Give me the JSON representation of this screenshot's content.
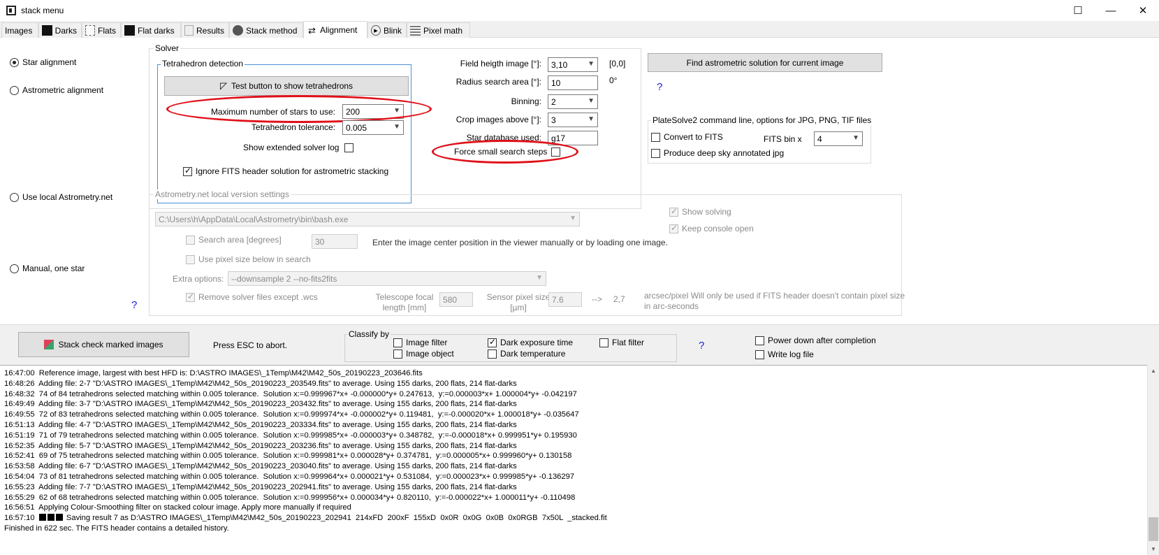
{
  "window": {
    "title": "stack menu",
    "minimize": "—",
    "maximize": "☐",
    "close": "✕"
  },
  "tabs": [
    {
      "label": "Images",
      "icon": "none"
    },
    {
      "label": "Darks",
      "icon": "darks-icon"
    },
    {
      "label": "Flats",
      "icon": "flats-icon"
    },
    {
      "label": "Flat darks",
      "icon": "flat-darks-icon"
    },
    {
      "label": "Results",
      "icon": "results-icon"
    },
    {
      "label": "Stack method",
      "icon": "stack-method-icon"
    },
    {
      "label": "Alignment",
      "icon": "alignment-icon"
    },
    {
      "label": "Blink",
      "icon": "blink-icon"
    },
    {
      "label": "Pixel math",
      "icon": "pixel-math-icon"
    }
  ],
  "alignment": {
    "radios": {
      "star": "Star alignment",
      "astrometric": "Astrometric alignment",
      "local_astrometry": "Use local Astrometry.net",
      "manual": "Manual, one star"
    },
    "solver": {
      "group_label": "Solver",
      "tetra_group_label": "Tetrahedron detection",
      "test_button": "Test button to show tetrahedrons",
      "max_stars_label": "Maximum number of stars to use:",
      "max_stars_value": "200",
      "tolerance_label": "Tetrahedron tolerance:",
      "tolerance_value": "0.005",
      "show_log_label": "Show extended solver log",
      "field_label": "Field heigth image [°]:",
      "field_value": "3,10",
      "field_readout": "[0,0]",
      "radius_label": "Radius search area [°]:",
      "radius_value": "10",
      "radius_unit": "0°",
      "binning_label": "Binning:",
      "binning_value": "2",
      "crop_label": "Crop images above [°]:",
      "crop_value": "3",
      "db_label": "Star database used:",
      "db_value": "g17",
      "force_label": "Force small search steps"
    },
    "find_button": "Find astrometric solution for current image",
    "help": "?",
    "platesolve": {
      "group_label": "PlateSolve2 command line, options for JPG, PNG, TIF files",
      "convert_label": "Convert to FITS",
      "bin_label": "FITS bin x",
      "bin_value": "4",
      "annotated_label": "Produce deep sky annotated jpg"
    },
    "ignore_fits_label": "Ignore FITS header solution for astrometric stacking",
    "astrometry_net": {
      "group_label": "Astrometry.net local version settings",
      "path_value": "C:\\Users\\h\\AppData\\Local\\Astrometry\\bin\\bash.exe",
      "show_solving": "Show solving",
      "keep_console": "Keep console open",
      "search_area_label": "Search area [degrees]",
      "search_area_value": "30",
      "center_hint": "Enter the image center position in the viewer manually or by loading one image.",
      "pixel_size_label": "Use pixel size below in search",
      "extra_label": "Extra options:",
      "extra_value": "--downsample 2 --no-fits2fits",
      "remove_label": "Remove solver files except .wcs",
      "focal_label_1": "Telescope focal",
      "focal_label_2": "length [mm]",
      "focal_value": "580",
      "sensor_label_1": "Sensor pixel size",
      "sensor_label_2": "[µm]",
      "sensor_value": "7.6",
      "arrow": "-->",
      "scale_value": "2,7",
      "scale_note_1": "arcsec/pixel  Will only be used if FITS header doesn't contain pixel size",
      "scale_note_2": "in arc-seconds"
    }
  },
  "controls": {
    "stack_button": "Stack check marked images",
    "esc_hint": "Press ESC to abort.",
    "classify_label": "Classify by",
    "image_filter": "Image filter",
    "image_object": "Image object",
    "dark_exposure": "Dark exposure time",
    "dark_temperature": "Dark temperature",
    "flat_filter": "Flat filter",
    "help": "?",
    "power_down": "Power down after completion",
    "write_log": "Write log file"
  },
  "log": [
    "16:47:00  Reference image, largest with best HFD is: D:\\ASTRO IMAGES\\_1Temp\\M42\\M42_50s_20190223_203646.fits",
    "16:48:26  Adding file: 2-7 \"D:\\ASTRO IMAGES\\_1Temp\\M42\\M42_50s_20190223_203549.fits\" to average. Using 155 darks, 200 flats, 214 flat-darks",
    "16:48:32  74 of 84 tetrahedrons selected matching within 0.005 tolerance.  Solution x:=0.999967*x+ -0.000000*y+ 0.247613,  y:=0.000003*x+ 1.000004*y+ -0.042197",
    "16:49:49  Adding file: 3-7 \"D:\\ASTRO IMAGES\\_1Temp\\M42\\M42_50s_20190223_203432.fits\" to average. Using 155 darks, 200 flats, 214 flat-darks",
    "16:49:55  72 of 83 tetrahedrons selected matching within 0.005 tolerance.  Solution x:=0.999974*x+ -0.000002*y+ 0.119481,  y:=-0.000020*x+ 1.000018*y+ -0.035647",
    "16:51:13  Adding file: 4-7 \"D:\\ASTRO IMAGES\\_1Temp\\M42\\M42_50s_20190223_203334.fits\" to average. Using 155 darks, 200 flats, 214 flat-darks",
    "16:51:19  71 of 79 tetrahedrons selected matching within 0.005 tolerance.  Solution x:=0.999985*x+ -0.000003*y+ 0.348782,  y:=-0.000018*x+ 0.999951*y+ 0.195930",
    "16:52:35  Adding file: 5-7 \"D:\\ASTRO IMAGES\\_1Temp\\M42\\M42_50s_20190223_203236.fits\" to average. Using 155 darks, 200 flats, 214 flat-darks",
    "16:52:41  69 of 75 tetrahedrons selected matching within 0.005 tolerance.  Solution x:=0.999981*x+ 0.000028*y+ 0.374781,  y:=0.000005*x+ 0.999960*y+ 0.130158",
    "16:53:58  Adding file: 6-7 \"D:\\ASTRO IMAGES\\_1Temp\\M42\\M42_50s_20190223_203040.fits\" to average. Using 155 darks, 200 flats, 214 flat-darks",
    "16:54:04  73 of 81 tetrahedrons selected matching within 0.005 tolerance.  Solution x:=0.999964*x+ 0.000021*y+ 0.531084,  y:=0.000023*x+ 0.999985*y+ -0.136297",
    "16:55:23  Adding file: 7-7 \"D:\\ASTRO IMAGES\\_1Temp\\M42\\M42_50s_20190223_202941.fits\" to average. Using 155 darks, 200 flats, 214 flat-darks",
    "16:55:29  62 of 68 tetrahedrons selected matching within 0.005 tolerance.  Solution x:=0.999956*x+ 0.000034*y+ 0.820110,  y:=-0.000022*x+ 1.000011*y+ -0.110498",
    "16:56:51  Applying Colour-Smoothing filter on stacked colour image. Apply more manually if required"
  ],
  "log_last_time": "16:57:10",
  "log_last_line": " Saving result 7 as D:\\ASTRO IMAGES\\_1Temp\\M42\\M42_50s_20190223_202941  214xFD  200xF  155xD  0x0R  0x0G  0x0B  0x0RGB  7x50L  _stacked.fit",
  "log_finished": "Finished in 622 sec. The FITS header contains a detailed history."
}
